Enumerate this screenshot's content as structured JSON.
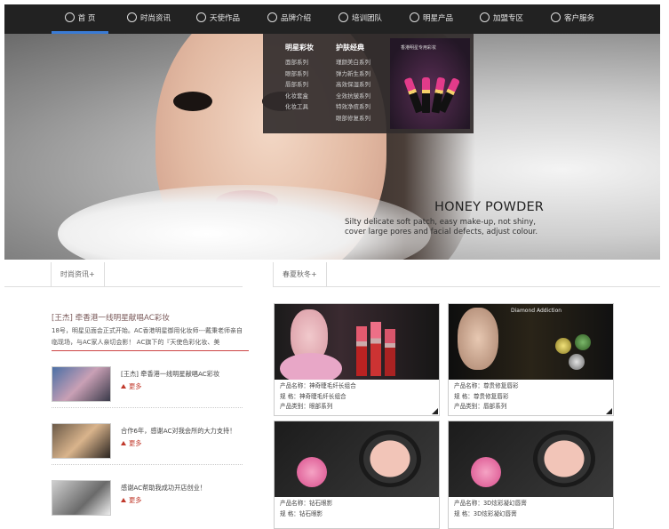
{
  "nav": {
    "items": [
      {
        "label": "首 页",
        "icon": "home-icon",
        "active": true
      },
      {
        "label": "时尚资讯",
        "icon": "news-icon"
      },
      {
        "label": "天使作品",
        "icon": "star-icon"
      },
      {
        "label": "品牌介绍",
        "icon": "brand-icon"
      },
      {
        "label": "培训团队",
        "icon": "team-icon"
      },
      {
        "label": "明星产品",
        "icon": "product-icon"
      },
      {
        "label": "加盟专区",
        "icon": "plus-icon"
      },
      {
        "label": "客户服务",
        "icon": "phone-icon"
      }
    ]
  },
  "dropdown": {
    "col1": {
      "heading": "明星彩妆",
      "items": [
        "面部系列",
        "眼部系列",
        "唇部系列",
        "化妆套盒",
        "化妆工具"
      ]
    },
    "col2": {
      "heading": "护肤经典",
      "items": [
        "瑾颜美白系列",
        "弹力新生系列",
        "高效保湿系列",
        "全效抗皱系列",
        "特效净痘系列",
        "眼部修复系列"
      ]
    },
    "promo_caption": "香港明星专用彩妆"
  },
  "hero": {
    "title": "HONEY POWDER",
    "subtitle": "Silty delicate soft patch, easy make-up, not shiny, cover large pores and facial defects, adjust colour."
  },
  "left_tabs": {
    "tab": "时尚资讯+"
  },
  "right_tabs": {
    "tab": "春夏秋冬+"
  },
  "news": {
    "lead_title": "[王杰] 牵香港一线明星献唱AC彩妆",
    "lead_text": "18号，明星见面会正式开始。AC香港明星御用化妆师---戴秉老师亲自临现场，与AC家人亲切会影！ AC旗下的『天使色彩化妆、美",
    "items": [
      {
        "title": "[王杰] 牵香港一线明星献唱AC彩妆",
        "more": "更多"
      },
      {
        "title": "合作6年，感谢AC对我会所的大力支持！",
        "more": "更多"
      },
      {
        "title": "感谢AC帮助我成功开店创业！",
        "more": "更多"
      }
    ]
  },
  "products": [
    {
      "name": "产品名称：神奇睫毛纤长组合",
      "spec": "规 格：神奇睫毛纤长组合",
      "category": "产品类别：眼部系列"
    },
    {
      "name": "产品名称：尊贵修复唇彩",
      "spec": "规 格：尊贵修复唇彩",
      "category": "产品类别：唇部系列",
      "img_caption": "Diamond Addiction"
    },
    {
      "name": "产品名称：钻石眼影",
      "spec": "规 格：钻石眼影",
      "category": ""
    },
    {
      "name": "产品名称：3D炫彩凝幻唇膏",
      "spec": "规 格：3D炫彩凝幻唇膏",
      "category": ""
    }
  ],
  "colors": {
    "nav_bg": "#222222",
    "accent": "#3a7bd5",
    "more_red": "#c0392b"
  }
}
